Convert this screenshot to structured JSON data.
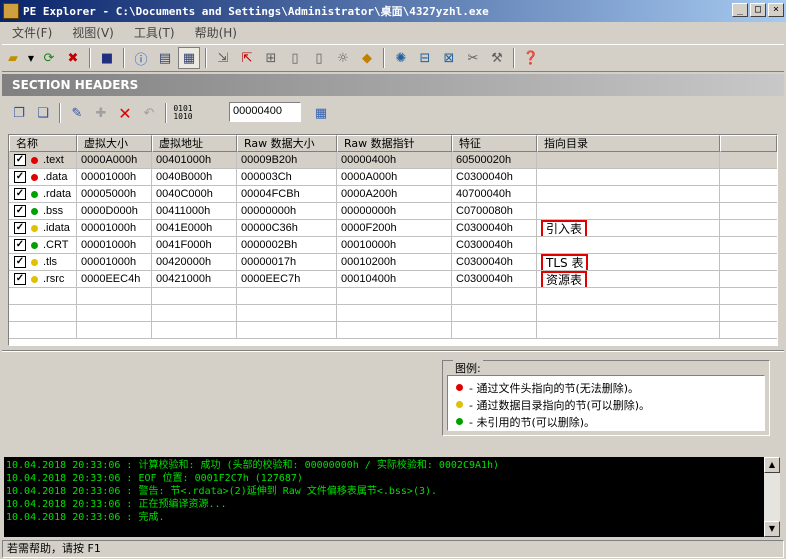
{
  "window": {
    "title": "PE Explorer - C:\\Documents and Settings\\Administrator\\桌面\\4327yzhl.exe",
    "minimize": "_",
    "maximize": "□",
    "close": "×"
  },
  "menu": [
    "文件(F)",
    "视图(V)",
    "工具(T)",
    "帮助(H)"
  ],
  "banner": "SECTION HEADERS",
  "offset_value": "00000400",
  "table": {
    "columns": [
      "名称",
      "虚拟大小",
      "虚拟地址",
      "Raw 数据大小",
      "Raw 数据指针",
      "特征",
      "指向目录"
    ],
    "rows": [
      {
        "name": ".text",
        "dot": "#e00000",
        "vsize": "0000A000h",
        "vaddr": "00401000h",
        "rsize": "00009B20h",
        "rptr": "00000400h",
        "flags": "60500020h",
        "dir": ""
      },
      {
        "name": ".data",
        "dot": "#e00000",
        "vsize": "00001000h",
        "vaddr": "0040B000h",
        "rsize": "000003Ch",
        "rptr": "0000A000h",
        "flags": "C0300040h",
        "dir": ""
      },
      {
        "name": ".rdata",
        "dot": "#00a000",
        "vsize": "00005000h",
        "vaddr": "0040C000h",
        "rsize": "00004FCBh",
        "rptr": "0000A200h",
        "flags": "40700040h",
        "dir": ""
      },
      {
        "name": ".bss",
        "dot": "#00a000",
        "vsize": "0000D000h",
        "vaddr": "00411000h",
        "rsize": "00000000h",
        "rptr": "00000000h",
        "flags": "C0700080h",
        "dir": ""
      },
      {
        "name": ".idata",
        "dot": "#e0c000",
        "vsize": "00001000h",
        "vaddr": "0041E000h",
        "rsize": "00000C36h",
        "rptr": "0000F200h",
        "flags": "C0300040h",
        "dir": "引入表"
      },
      {
        "name": ".CRT",
        "dot": "#00a000",
        "vsize": "00001000h",
        "vaddr": "0041F000h",
        "rsize": "0000002Bh",
        "rptr": "00010000h",
        "flags": "C0300040h",
        "dir": ""
      },
      {
        "name": ".tls",
        "dot": "#e0c000",
        "vsize": "00001000h",
        "vaddr": "00420000h",
        "rsize": "00000017h",
        "rptr": "00010200h",
        "flags": "C0300040h",
        "dir": "TLS 表"
      },
      {
        "name": ".rsrc",
        "dot": "#e0c000",
        "vsize": "0000EEC4h",
        "vaddr": "00421000h",
        "rsize": "0000EEC7h",
        "rptr": "00010400h",
        "flags": "C0300040h",
        "dir": "资源表"
      }
    ]
  },
  "legend": {
    "title": "图例:",
    "items": [
      {
        "color": "#e00000",
        "text": "- 通过文件头指向的节(无法删除)。"
      },
      {
        "color": "#e0c000",
        "text": "- 通过数据目录指向的节(可以删除)。"
      },
      {
        "color": "#00a000",
        "text": "- 未引用的节(可以删除)。"
      }
    ]
  },
  "log": [
    "10.04.2018 20:33:06 : 计算校验和: 成功 (头部的校验和: 00000000h / 实际校验和: 0002C9A1h)",
    "10.04.2018 20:33:06 : EOF 位置: 0001F2C7h  (127687)",
    "10.04.2018 20:33:06 : 警告: 节<.rdata>(2)延伸到 Raw 文件偏移表属节<.bss>(3).",
    "10.04.2018 20:33:06 : 正在预编译资源...",
    "10.04.2018 20:33:06 : 完成."
  ],
  "status": "若需帮助，请按 F1"
}
